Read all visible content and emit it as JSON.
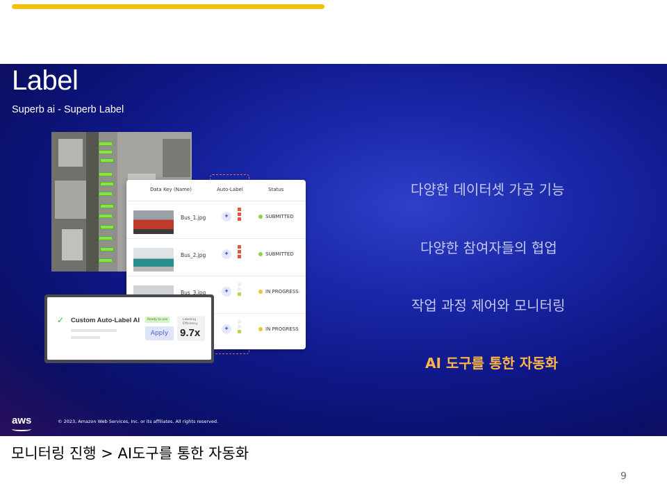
{
  "accent_color": "#f5c00c",
  "highlight_color": "#ffb547",
  "slide": {
    "title": "Label",
    "subtitle": "Superb ai - Superb Label",
    "table": {
      "columns": [
        "Data Key (Name)",
        "Auto-Label",
        "Status"
      ],
      "rows": [
        {
          "name": "Bus_1.jpg",
          "status": "SUBMITTED",
          "status_color": "#8fd04a"
        },
        {
          "name": "Bus_2.jpg",
          "status": "SUBMITTED",
          "status_color": "#8fd04a"
        },
        {
          "name": "Bus_3.jpg",
          "status": "IN PROGRESS",
          "status_color": "#f0c23a"
        },
        {
          "name": "",
          "status": "IN PROGRESS",
          "status_color": "#f0c23a"
        }
      ]
    },
    "popup": {
      "title": "Custom Auto-Label AI",
      "ready_label": "Ready to use",
      "apply_label": "Apply",
      "efficiency_label": "Labeling Efficiency",
      "efficiency_value": "9.7x"
    },
    "features": [
      "다양한 데이터셋 가공 기능",
      "다양한 참여자들의 협업",
      "작업 과정 제어와 모니터링",
      "AI 도구를 통한 자동화"
    ],
    "aws_logo": "aws",
    "copyright": "© 2023, Amazon Web Services, Inc. or its affiliates. All rights reserved."
  },
  "caption": "모니터링 진행 > AI도구를 통한 자동화",
  "page_number": "9"
}
